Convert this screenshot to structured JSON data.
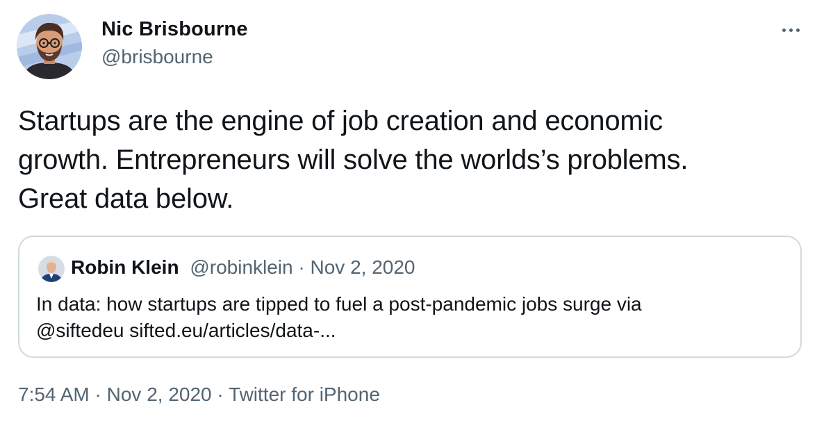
{
  "author": {
    "display_name": "Nic Brisbourne",
    "handle": "@brisbourne"
  },
  "tweet": {
    "text_line1": "Startups are the engine of job creation and economic",
    "text_line2": "growth. Entrepreneurs will solve the worlds’s problems.",
    "text_line3": "Great data below."
  },
  "quoted_tweet": {
    "display_name": "Robin Klein",
    "handle": "@robinklein",
    "separator": " · ",
    "date": "Nov 2, 2020",
    "text_line1": "In data: how startups are tipped to fuel a post-pandemic jobs surge via",
    "text_line2": "@siftedeu sifted.eu/articles/data-..."
  },
  "meta": {
    "time": "7:54 AM",
    "separator": " · ",
    "date": "Nov 2, 2020",
    "source": "Twitter for iPhone"
  },
  "icons": {
    "more": "more-horizontal-icon"
  },
  "colors": {
    "text_primary": "#0f1419",
    "text_secondary": "#536471",
    "border": "#cfd9de",
    "avatar_bg": "#b9cdea"
  }
}
